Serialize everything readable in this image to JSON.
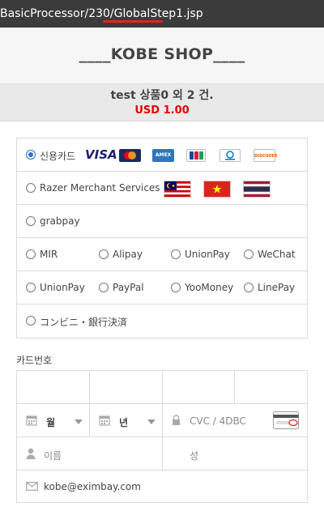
{
  "url": {
    "prefix": "BasicProcessor/230/",
    "highlight": "GlobalStep1",
    "suffix": ".jsp"
  },
  "header": {
    "title": "____KOBE SHOP____"
  },
  "summary": {
    "product": "test 상품0 외 2 건.",
    "amount": "USD 1.00"
  },
  "methods": {
    "credit_card": "신용카드",
    "razer": "Razer Merchant Services",
    "grabpay": "grabpay",
    "mir": "MIR",
    "alipay": "Alipay",
    "unionpay1": "UnionPay",
    "wechat": "WeChat",
    "unionpay2": "UnionPay",
    "paypal": "PayPal",
    "yoomoney": "YooMoney",
    "linepay": "LinePay",
    "konbini": "コンビニ・銀行決済"
  },
  "card_logos": {
    "visa": "VISA",
    "mastercard": "MC",
    "amex": "AMEX",
    "jcb": "JCB",
    "diners": "Diners",
    "discover": "DISCOVER"
  },
  "card_form": {
    "label": "카드번호",
    "month": "월",
    "year": "년",
    "cvc_placeholder": "CVC / 4DBC",
    "name_placeholder": "이름",
    "surname_placeholder": "성",
    "email": "kobe@eximbay.com"
  },
  "colors": {
    "accent_red": "#e60000",
    "radio_blue": "#2a6fd6",
    "url_underline": "#e0261b"
  }
}
